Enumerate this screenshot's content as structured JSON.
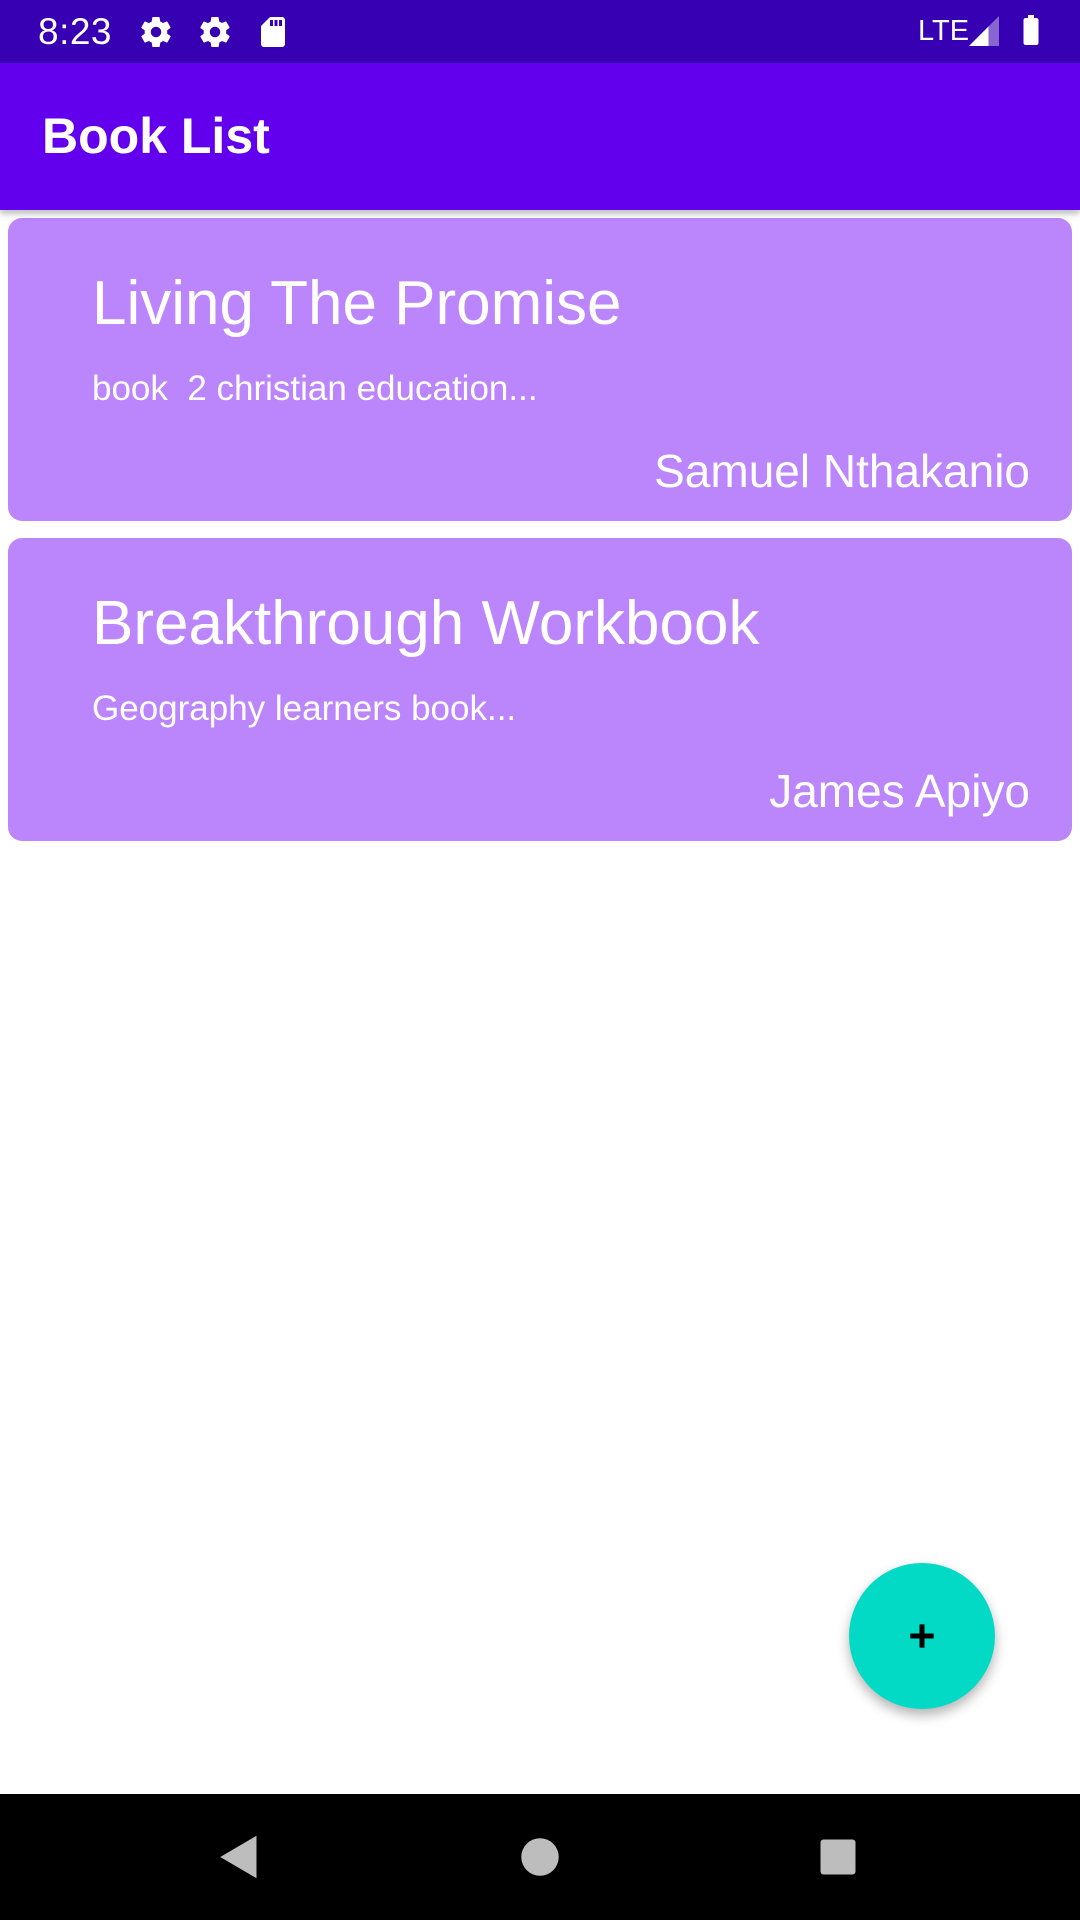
{
  "status_bar": {
    "time": "8:23",
    "network": "LTE",
    "icons": [
      "gear-icon",
      "gear-icon",
      "sd-card-icon",
      "signal-icon",
      "battery-icon"
    ]
  },
  "app_bar": {
    "title": "Book List"
  },
  "books": [
    {
      "title": "Living The Promise",
      "description": "book  2 christian education...",
      "author": "Samuel Nthakanio"
    },
    {
      "title": "Breakthrough Workbook",
      "description": "Geography learners book...",
      "author": "James Apiyo"
    }
  ],
  "fab": {
    "icon": "plus-icon"
  },
  "nav_bar": {
    "icons": [
      "back-icon",
      "home-icon",
      "recents-icon"
    ]
  },
  "colors": {
    "status_bar": "#3700b3",
    "primary": "#6200ee",
    "card": "#bb86fc",
    "accent": "#03dac5"
  }
}
